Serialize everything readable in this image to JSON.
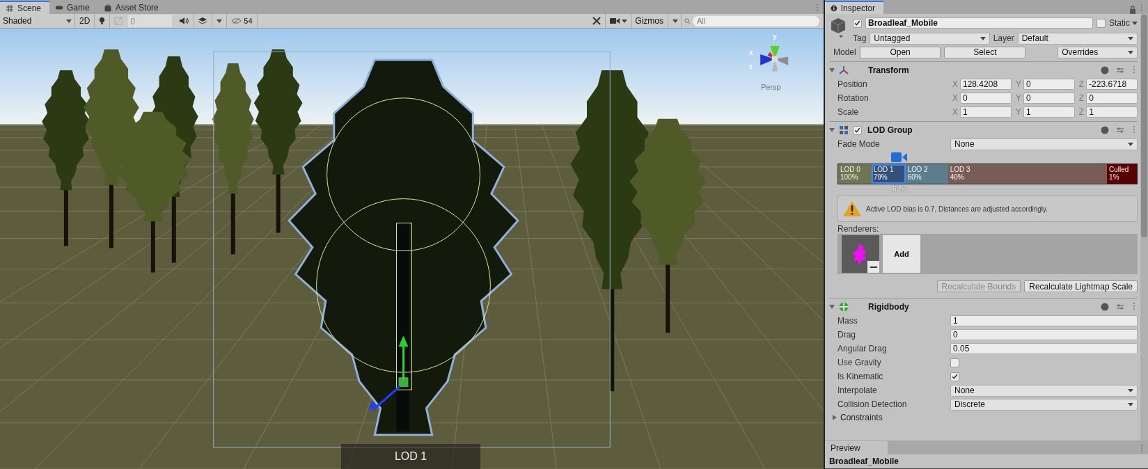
{
  "scene_tabs": [
    {
      "label": "Scene",
      "selected": true
    },
    {
      "label": "Game",
      "selected": false
    },
    {
      "label": "Asset Store",
      "selected": false
    }
  ],
  "scene_toolbar": {
    "shading": "Shaded",
    "mode_2d": "2D",
    "fx_value": "0",
    "hidden_count": "54",
    "gizmos": "Gizmos",
    "search": {
      "placeholder": "All"
    }
  },
  "viewport": {
    "gizmo_axes": [
      "y",
      "x",
      "z"
    ],
    "projection": "Persp",
    "lod_label": "LOD 1"
  },
  "inspector": {
    "tab": "Inspector",
    "object": {
      "active": true,
      "name": "Broadleaf_Mobile",
      "static": false,
      "static_label": "Static"
    },
    "tag_label": "Tag",
    "tag": "Untagged",
    "layer_label": "Layer",
    "layer": "Default",
    "model_label": "Model",
    "model_buttons": [
      "Open",
      "Select"
    ],
    "overrides": "Overrides",
    "transform": {
      "title": "Transform",
      "expanded": true,
      "rows": [
        {
          "label": "Position",
          "fields": [
            {
              "axis": "X",
              "value": "128.4208"
            },
            {
              "axis": "Y",
              "value": "0"
            },
            {
              "axis": "Z",
              "value": "-223.6718"
            }
          ]
        },
        {
          "label": "Rotation",
          "fields": [
            {
              "axis": "X",
              "value": "0"
            },
            {
              "axis": "Y",
              "value": "0"
            },
            {
              "axis": "Z",
              "value": "0"
            }
          ]
        },
        {
          "label": "Scale",
          "fields": [
            {
              "axis": "X",
              "value": "1"
            },
            {
              "axis": "Y",
              "value": "1"
            },
            {
              "axis": "Z",
              "value": "1"
            }
          ]
        }
      ]
    },
    "lod_group": {
      "title": "LOD Group",
      "enabled": true,
      "expanded": true,
      "fade_mode_label": "Fade Mode",
      "fade_mode": "None",
      "camera_marker": {
        "reading": "63%"
      },
      "levels": [
        {
          "name": "LOD 0",
          "percent": "100%",
          "color": "#6f7452",
          "selected": false
        },
        {
          "name": "LOD 1",
          "percent": "79%",
          "color": "#34507a",
          "selected": true
        },
        {
          "name": "LOD 2",
          "percent": "60%",
          "color": "#5c7e8c",
          "selected": false
        },
        {
          "name": "LOD 3",
          "percent": "40%",
          "color": "#7a5c56",
          "selected": false
        },
        {
          "name": "Culled",
          "percent": "1%",
          "color": "#5a0000",
          "selected": false
        }
      ],
      "warning": "Active LOD bias is 0.7. Distances are adjusted accordingly.",
      "renderers_label": "Renderers:",
      "add_button": "Add",
      "buttons": [
        {
          "label": "Recalculate Bounds",
          "disabled": true
        },
        {
          "label": "Recalculate Lightmap Scale",
          "disabled": false
        }
      ]
    },
    "rigidbody": {
      "title": "Rigidbody",
      "expanded": true,
      "properties": [
        {
          "kind": "field",
          "label": "Mass",
          "value": "1"
        },
        {
          "kind": "field",
          "label": "Drag",
          "value": "0"
        },
        {
          "kind": "field",
          "label": "Angular Drag",
          "value": "0.05"
        },
        {
          "kind": "checkbox",
          "label": "Use Gravity",
          "checked": false
        },
        {
          "kind": "checkbox",
          "label": "Is Kinematic",
          "checked": true
        },
        {
          "kind": "dropdown",
          "label": "Interpolate",
          "value": "None"
        },
        {
          "kind": "dropdown",
          "label": "Collision Detection",
          "value": "Discrete"
        }
      ],
      "constraints": {
        "label": "Constraints",
        "expanded": false
      }
    }
  },
  "preview": {
    "tab": "Preview",
    "title": "Broadleaf_Mobile"
  }
}
